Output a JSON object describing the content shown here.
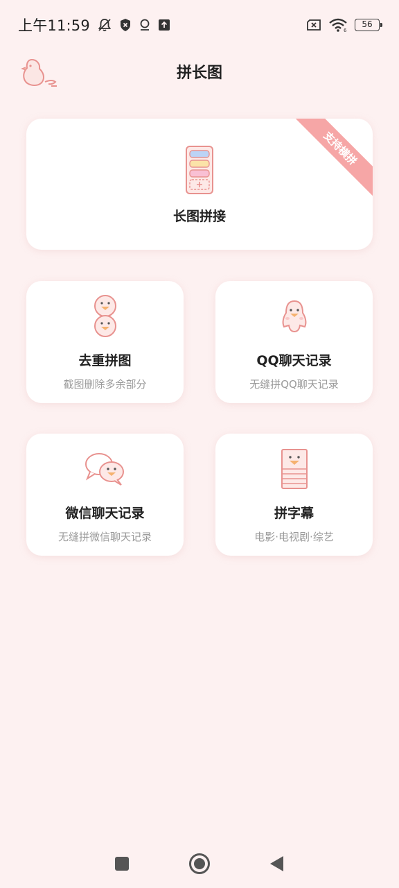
{
  "status_bar": {
    "time": "上午11:59",
    "battery": "56",
    "icons": [
      "bell-off-icon",
      "shield-icon",
      "location-icon",
      "upload-icon",
      "sim-off-icon",
      "wifi-icon",
      "battery-icon"
    ]
  },
  "header": {
    "title": "拼长图",
    "logo_icon": "penguin-logo-icon"
  },
  "cards": {
    "main": {
      "title": "长图拼接",
      "badge": "支持横拼",
      "icon": "long-image-icon"
    },
    "dedup": {
      "title": "去重拼图",
      "subtitle": "截图删除多余部分",
      "icon": "stacked-penguins-icon"
    },
    "qq": {
      "title": "QQ聊天记录",
      "subtitle": "无缝拼QQ聊天记录",
      "icon": "qq-penguin-icon"
    },
    "wechat": {
      "title": "微信聊天记录",
      "subtitle": "无缝拼微信聊天记录",
      "icon": "chat-bubbles-icon"
    },
    "subtitle_stitch": {
      "title": "拼字幕",
      "subtitle": "电影·电视剧·综艺",
      "icon": "subtitle-strip-icon"
    }
  },
  "nav": {
    "icons": [
      "recents-square-icon",
      "home-circle-icon",
      "back-triangle-icon"
    ]
  },
  "colors": {
    "background": "#fdf1f1",
    "accent": "#f6a6a6",
    "icon_stroke": "#e8928f",
    "title_text": "#222222",
    "subtitle_text": "#9a9a9a"
  }
}
